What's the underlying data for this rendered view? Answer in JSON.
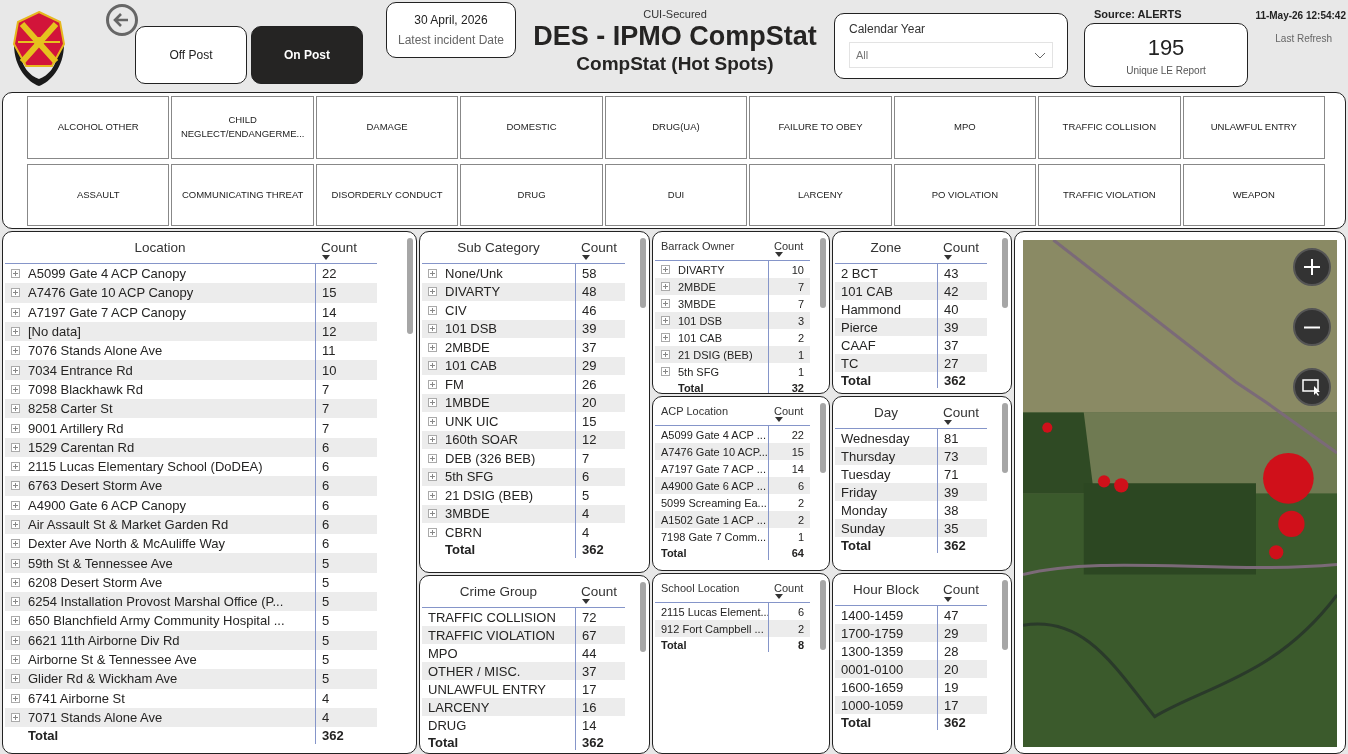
{
  "post_toggle": [
    {
      "label": "Off Post",
      "selected": false
    },
    {
      "label": "On Post",
      "selected": true
    }
  ],
  "latest_incident": {
    "value": "30 April, 2026",
    "label": "Latest incident Date"
  },
  "classification": "CUI-Secured",
  "title": "DES - IPMO CompStat",
  "subtitle": "CompStat (Hot Spots)",
  "calendar_year": {
    "label": "Calendar Year",
    "value": "All"
  },
  "source": "Source: ALERTS",
  "kpi": {
    "value": "195",
    "label": "Unique LE Report"
  },
  "refresh": {
    "time": "11-May-26 12:54:42",
    "label": "Last Refresh"
  },
  "offense_tiles": [
    "ALCOHOL OTHER",
    "CHILD NEGLECT/ENDANGERME...",
    "DAMAGE",
    "DOMESTIC",
    "DRUG(UA)",
    "FAILURE TO OBEY",
    "MPO",
    "TRAFFIC COLLISION",
    "UNLAWFUL ENTRY",
    "ASSAULT",
    "COMMUNICATING THREAT",
    "DISORDERLY CONDUCT",
    "DRUG",
    "DUI",
    "LARCENY",
    "PO VIOLATION",
    "TRAFFIC VIOLATION",
    "WEAPON"
  ],
  "columns": [
    [
      {
        "kind": "standard",
        "heading": "Location",
        "count_heading": "Count",
        "expandable": true,
        "total_label": "Total",
        "total": "362",
        "rows": [
          {
            "name": "A5099 Gate 4 ACP Canopy",
            "count": "22"
          },
          {
            "name": "A7476 Gate 10 ACP Canopy",
            "count": "15"
          },
          {
            "name": "A7197 Gate 7 ACP Canopy",
            "count": "14"
          },
          {
            "name": "[No data]",
            "count": "12"
          },
          {
            "name": "7076 Stands Alone Ave",
            "count": "11"
          },
          {
            "name": "7034 Entrance Rd",
            "count": "10"
          },
          {
            "name": "7098 Blackhawk Rd",
            "count": "7"
          },
          {
            "name": "8258 Carter St",
            "count": "7"
          },
          {
            "name": "9001 Artillery Rd",
            "count": "7"
          },
          {
            "name": "1529 Carentan Rd",
            "count": "6"
          },
          {
            "name": "2115 Lucas Elementary School (DoDEA)",
            "count": "6"
          },
          {
            "name": "6763 Desert Storm Ave",
            "count": "6"
          },
          {
            "name": "A4900 Gate 6 ACP Canopy",
            "count": "6"
          },
          {
            "name": "Air Assault St & Market Garden Rd",
            "count": "6"
          },
          {
            "name": "Dexter Ave North & McAuliffe Way",
            "count": "6"
          },
          {
            "name": "59th St & Tennessee Ave",
            "count": "5"
          },
          {
            "name": "6208 Desert Storm Ave",
            "count": "5"
          },
          {
            "name": "6254 Installation Provost Marshal Office (P...",
            "count": "5"
          },
          {
            "name": "650 Blanchfield Army Community Hospital ...",
            "count": "5"
          },
          {
            "name": "6621 11th Airborne Div Rd",
            "count": "5"
          },
          {
            "name": "Airborne St & Tennessee Ave",
            "count": "5"
          },
          {
            "name": "Glider Rd & Wickham Ave",
            "count": "5"
          },
          {
            "name": "6741 Airborne St",
            "count": "4"
          },
          {
            "name": "7071 Stands Alone Ave",
            "count": "4"
          }
        ]
      }
    ],
    [
      {
        "kind": "standard",
        "heading": "Sub Category",
        "count_heading": "Count",
        "expandable": true,
        "total_label": "Total",
        "total": "362",
        "rows": [
          {
            "name": "None/Unk",
            "count": "58"
          },
          {
            "name": "DIVARTY",
            "count": "48"
          },
          {
            "name": "CIV",
            "count": "46"
          },
          {
            "name": "101 DSB",
            "count": "39"
          },
          {
            "name": "2MBDE",
            "count": "37"
          },
          {
            "name": "101 CAB",
            "count": "29"
          },
          {
            "name": "FM",
            "count": "26"
          },
          {
            "name": "1MBDE",
            "count": "20"
          },
          {
            "name": "UNK UIC",
            "count": "15"
          },
          {
            "name": "160th SOAR",
            "count": "12"
          },
          {
            "name": "DEB (326 BEB)",
            "count": "7"
          },
          {
            "name": "5th SFG",
            "count": "6"
          },
          {
            "name": "21 DSIG (BEB)",
            "count": "5"
          },
          {
            "name": "3MBDE",
            "count": "4"
          },
          {
            "name": "CBRN",
            "count": "4"
          }
        ]
      },
      {
        "kind": "standard",
        "heading": "Crime Group",
        "count_heading": "Count",
        "expandable": false,
        "total_label": "Total",
        "total": "362",
        "rows": [
          {
            "name": "TRAFFIC COLLISION",
            "count": "72"
          },
          {
            "name": "TRAFFIC VIOLATION",
            "count": "67"
          },
          {
            "name": "MPO",
            "count": "44"
          },
          {
            "name": "OTHER / MISC.",
            "count": "37"
          },
          {
            "name": "UNLAWFUL ENTRY",
            "count": "17"
          },
          {
            "name": "LARCENY",
            "count": "16"
          },
          {
            "name": "DRUG",
            "count": "14"
          }
        ]
      }
    ],
    [
      {
        "kind": "compact",
        "heading": "Barrack Owner",
        "count_heading": "Count",
        "expandable": true,
        "total_label": "Total",
        "total": "32",
        "rows": [
          {
            "name": "DIVARTY",
            "count": "10"
          },
          {
            "name": "2MBDE",
            "count": "7"
          },
          {
            "name": "3MBDE",
            "count": "7"
          },
          {
            "name": "101 DSB",
            "count": "3"
          },
          {
            "name": "101 CAB",
            "count": "2"
          },
          {
            "name": "21 DSIG (BEB)",
            "count": "1"
          },
          {
            "name": "5th SFG",
            "count": "1"
          }
        ]
      },
      {
        "kind": "compact",
        "heading": "ACP Location",
        "count_heading": "Count",
        "expandable": false,
        "total_label": "Total",
        "total": "64",
        "rows": [
          {
            "name": "A5099 Gate 4 ACP ...",
            "count": "22"
          },
          {
            "name": "A7476 Gate 10 ACP...",
            "count": "15"
          },
          {
            "name": "A7197 Gate 7 ACP ...",
            "count": "14"
          },
          {
            "name": "A4900 Gate 6 ACP ...",
            "count": "6"
          },
          {
            "name": "5099 Screaming Ea...",
            "count": "2"
          },
          {
            "name": "A1502 Gate 1 ACP ...",
            "count": "2"
          },
          {
            "name": "7198 Gate 7 Comm...",
            "count": "1"
          }
        ]
      },
      {
        "kind": "compact",
        "heading": "School Location",
        "count_heading": "Count",
        "expandable": false,
        "total_label": "Total",
        "total": "8",
        "rows": [
          {
            "name": "2115 Lucas Element...",
            "count": "6"
          },
          {
            "name": "912 Fort Campbell ...",
            "count": "2"
          }
        ]
      }
    ],
    [
      {
        "kind": "standard",
        "heading": "Zone",
        "count_heading": "Count",
        "expandable": false,
        "total_label": "Total",
        "total": "362",
        "rows": [
          {
            "name": "2 BCT",
            "count": "43"
          },
          {
            "name": "101 CAB",
            "count": "42"
          },
          {
            "name": "Hammond",
            "count": "40"
          },
          {
            "name": "Pierce",
            "count": "39"
          },
          {
            "name": "CAAF",
            "count": "37"
          },
          {
            "name": "TC",
            "count": "27"
          }
        ]
      },
      {
        "kind": "standard",
        "heading": "Day",
        "count_heading": "Count",
        "expandable": false,
        "total_label": "Total",
        "total": "362",
        "rows": [
          {
            "name": "Wednesday",
            "count": "81"
          },
          {
            "name": "Thursday",
            "count": "73"
          },
          {
            "name": "Tuesday",
            "count": "71"
          },
          {
            "name": "Friday",
            "count": "39"
          },
          {
            "name": "Monday",
            "count": "38"
          },
          {
            "name": "Sunday",
            "count": "35"
          }
        ]
      },
      {
        "kind": "standard",
        "heading": "Hour Block",
        "count_heading": "Count",
        "expandable": false,
        "total_label": "Total",
        "total": "362",
        "rows": [
          {
            "name": "1400-1459",
            "count": "47"
          },
          {
            "name": "1700-1759",
            "count": "29"
          },
          {
            "name": "1300-1359",
            "count": "28"
          },
          {
            "name": "0001-0100",
            "count": "20"
          },
          {
            "name": "1600-1659",
            "count": "19"
          },
          {
            "name": "1000-1059",
            "count": "17"
          }
        ]
      }
    ]
  ]
}
